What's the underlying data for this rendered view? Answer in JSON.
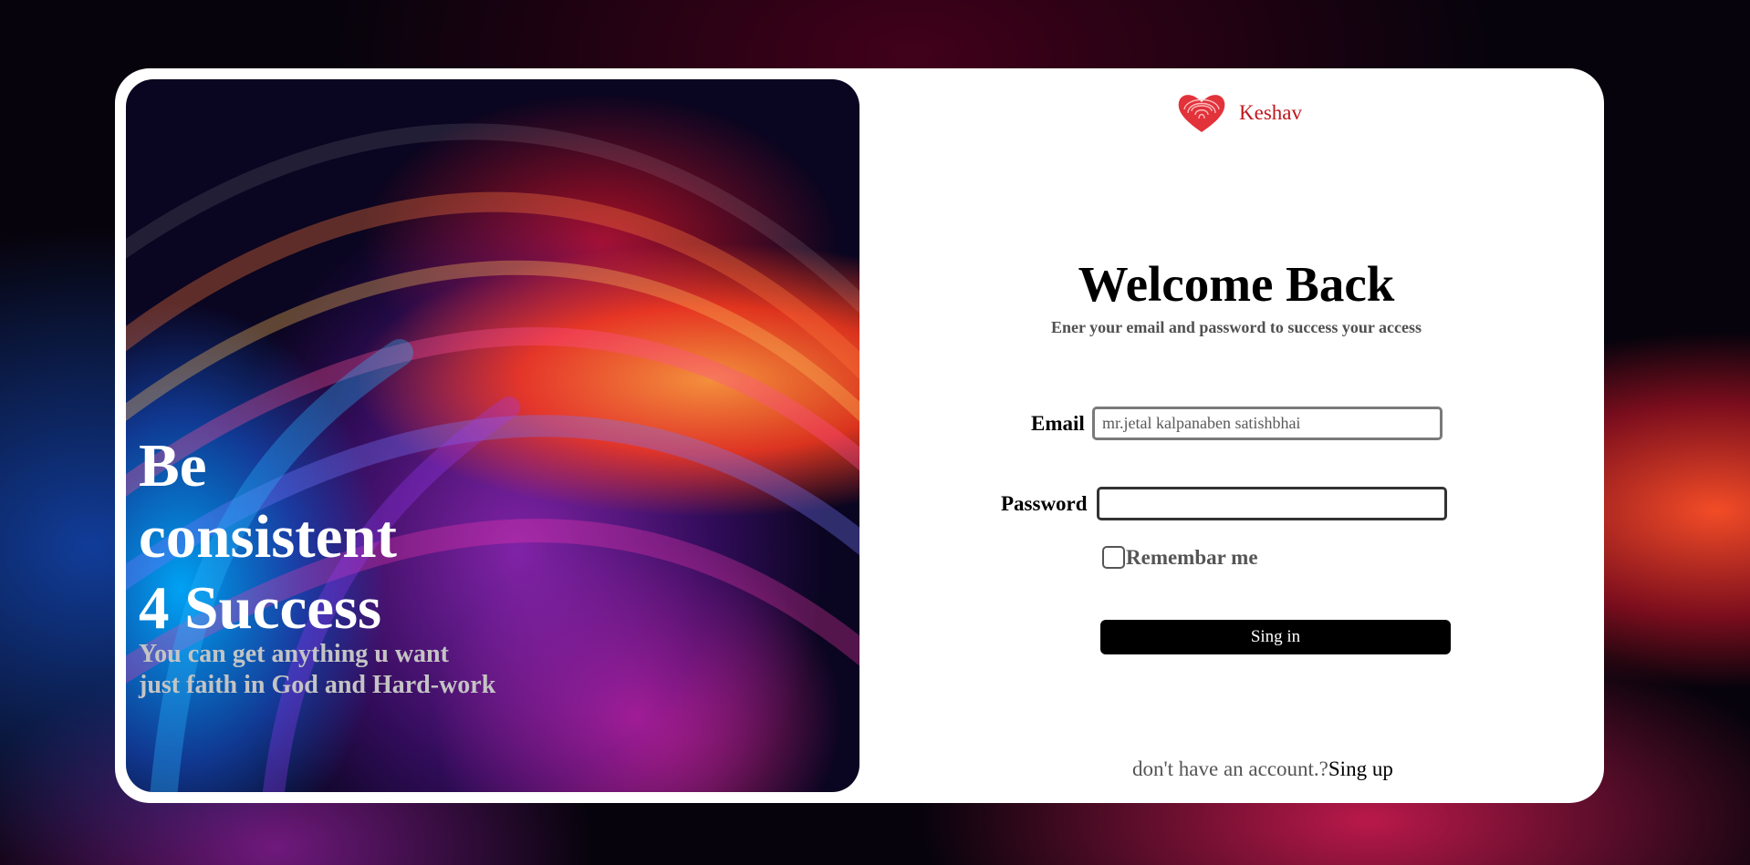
{
  "brand": {
    "name": "Keshav",
    "logo_icon": "fingerprint-heart-icon",
    "color": "#c0161d"
  },
  "hero": {
    "title_lines": [
      "Be",
      "consistent",
      "4 Success"
    ],
    "subtitle_lines": [
      "You can get anything u want",
      "just faith in God and Hard-work"
    ]
  },
  "form": {
    "heading": "Welcome Back",
    "tagline": "Ener your email and password to success your access",
    "email_label": "Email",
    "email_placeholder": "mr.jetal kalpanaben satishbhai",
    "email_value": "",
    "password_label": "Password",
    "password_value": "",
    "remember_label": "Remembar me",
    "remember_checked": false,
    "signin_label": "Sing in"
  },
  "footer": {
    "prompt": "don't have an account.?",
    "signup_link": "Sing up"
  }
}
